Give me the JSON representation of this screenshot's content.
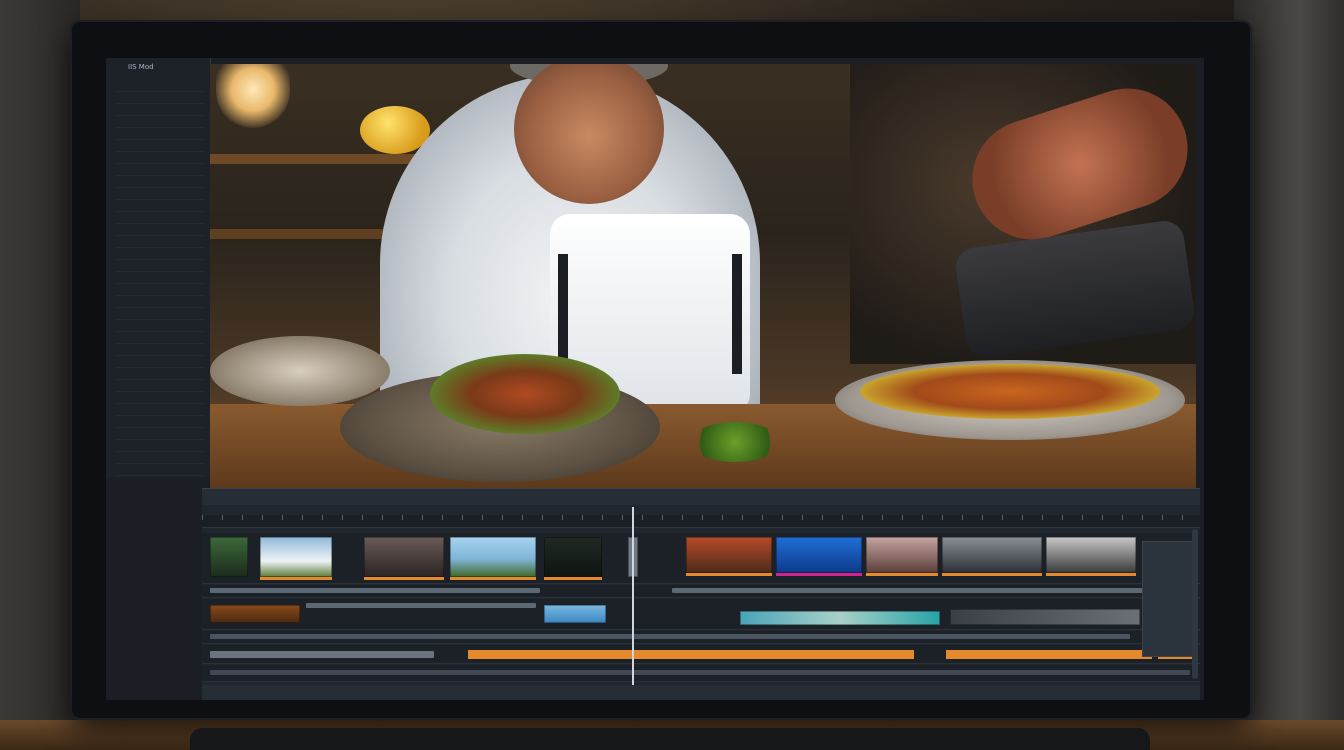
{
  "sidebar": {
    "title": "IIS Mod",
    "rows": [
      "",
      "",
      "",
      "",
      "",
      "",
      "",
      "",
      "",
      "",
      "",
      "",
      "",
      "",
      "",
      "",
      "",
      "",
      "",
      "",
      "",
      "",
      "",
      "",
      "",
      "",
      "",
      "",
      "",
      "",
      "",
      "",
      ""
    ]
  },
  "timeline": {
    "header": [
      "",
      "",
      "",
      "",
      "",
      "",
      ""
    ],
    "ruler_labels": [],
    "footer": [
      "",
      "",
      "",
      "",
      "",
      ""
    ]
  },
  "colors": {
    "accent_orange": "#e58a2c",
    "panel_bg": "#20262d",
    "magenta": "#d4238a",
    "teal": "#27a3a6"
  }
}
